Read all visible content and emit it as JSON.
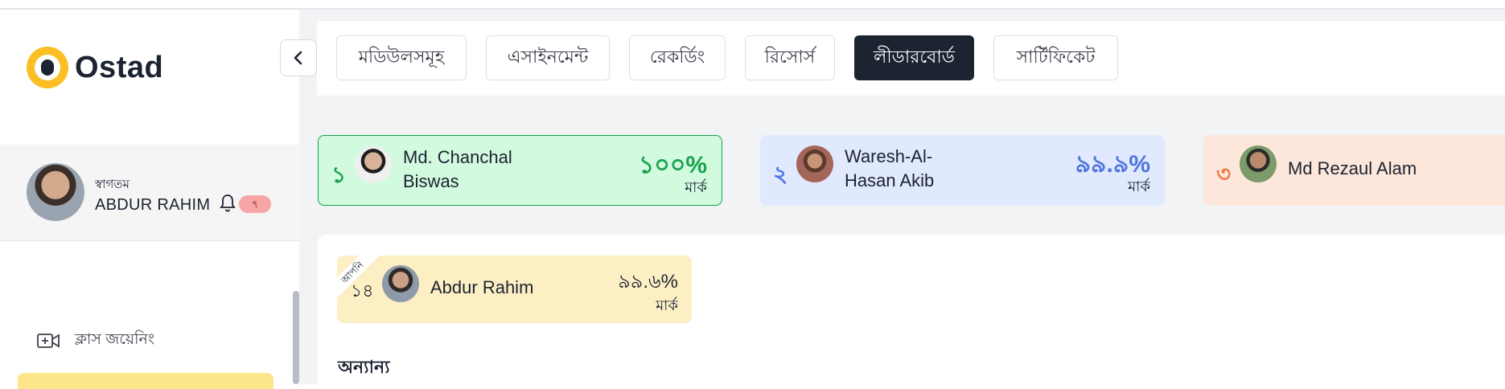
{
  "brand": {
    "name": "Ostad"
  },
  "user": {
    "welcome": "স্বাগতম",
    "name": "ABDUR RAHIM",
    "notifications": "৭"
  },
  "sidebar": {
    "items": [
      {
        "label": "ক্লাস জয়েনিং",
        "icon": "video-plus-icon"
      }
    ]
  },
  "tabs": [
    {
      "label": "মডিউলসমূহ",
      "active": false
    },
    {
      "label": "এসাইনমেন্ট",
      "active": false
    },
    {
      "label": "রেকর্ডিং",
      "active": false
    },
    {
      "label": "রিসোর্স",
      "active": false
    },
    {
      "label": "লীডারবোর্ড",
      "active": true
    },
    {
      "label": "সার্টিফিকেট",
      "active": false
    }
  ],
  "leaderboard": {
    "top": [
      {
        "rank": "১",
        "name": "Md. Chanchal Biswas",
        "score": "১০০%",
        "mark_label": "মার্ক"
      },
      {
        "rank": "২",
        "name": "Waresh-Al-Hasan Akib",
        "score": "৯৯.৯%",
        "mark_label": "মার্ক"
      },
      {
        "rank": "৩",
        "name": "Md Rezaul Alam"
      }
    ],
    "mine": {
      "ribbon": "আপনি",
      "rank": "১৪",
      "name": "Abdur Rahim",
      "score": "৯৯.৬%",
      "mark_label": "মার্ক"
    },
    "others_heading": "অন্যান্য"
  },
  "colors": {
    "accent": "#1c2331",
    "gold": "#fbbf24",
    "first": "#16a34a",
    "second": "#4f74e0",
    "third": "#f07a44"
  }
}
